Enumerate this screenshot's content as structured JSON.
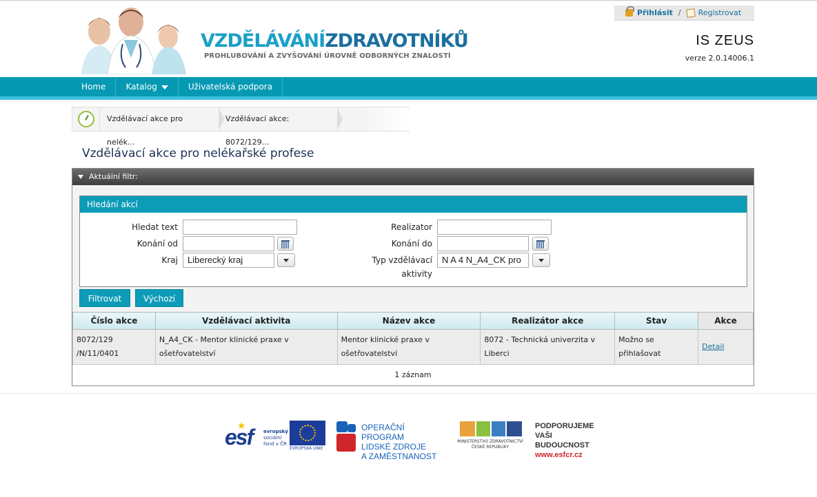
{
  "header": {
    "logo_title_a": "VZDĚLÁVÁNÍ",
    "logo_title_b": "ZDRAVOTNÍKŮ",
    "logo_subtitle": "PROHLUBOVÁNÍ A ZVYŠOVÁNÍ ÚROVNĚ ODBORNÝCH ZNALOSTÍ",
    "login_label": "Přihlásit",
    "separator": "/",
    "register_label": "Registrovat",
    "app_name": "IS ZEUS",
    "version": "verze 2.0.14006.1"
  },
  "nav": {
    "items": [
      "Home",
      "Katalog",
      "Uživatelská podpora"
    ]
  },
  "breadcrumb": {
    "items": [
      "Vzdělávací akce pro nelék...",
      "Vzdělávací akce: 8072/129..."
    ]
  },
  "page": {
    "title": "Vzdělávací akce pro nelékařské profese"
  },
  "filter": {
    "header": "Aktuální filtr:",
    "search_header": "Hledání akcí",
    "labels": {
      "hledat_text": "Hledat text",
      "konani_od": "Konání od",
      "kraj": "Kraj",
      "realizator": "Realizator",
      "konani_do": "Konání do",
      "typ_line1": "Typ vzdělávací",
      "typ_line2": "aktivity"
    },
    "values": {
      "hledat_text": "",
      "konani_od": "",
      "kraj": "Liberecký kraj",
      "realizator": "",
      "konani_do": "",
      "typ": "N A 4 N_A4_CK pro"
    },
    "buttons": {
      "filter": "Filtrovat",
      "default": "Výchozí"
    }
  },
  "table": {
    "columns": [
      "Číslo akce",
      "Vzdělávací aktivita",
      "Název akce",
      "Realizátor akce",
      "Stav",
      "Akce"
    ],
    "rows": [
      {
        "cislo_l1": "8072/129",
        "cislo_l2": "/N/11/0401",
        "aktivita_l1": "N_A4_CK - Mentor klinické praxe v",
        "aktivita_l2": "ošetřovatelství",
        "nazev_l1": "Mentor klinické praxe v",
        "nazev_l2": "ošetřovatelství",
        "realizator_l1": "8072 - Technická univerzita v",
        "realizator_l2": "Liberci",
        "stav_l1": "Možno se",
        "stav_l2": "přihlašovat",
        "akce": "Detail"
      }
    ],
    "footer": "1 záznam"
  },
  "footer_logos": {
    "esf_big": "esf",
    "esf_small_l1": "evropský",
    "esf_small_l2": "sociální",
    "esf_small_l3": "fond v ČR",
    "eu_label": "EVROPSKÁ UNIE",
    "op_l1": "OPERAČNÍ PROGRAM",
    "op_l2": "LIDSKÉ ZDROJE",
    "op_l3": "A ZAMĚSTNANOST",
    "mzd_l1": "MINISTERSTVO ZDRAVOTNICTVÍ",
    "mzd_l2": "ČESKÉ REPUBLIKY",
    "support_l1": "PODPORUJEME",
    "support_l2": "VAŠI BUDOUCNOST",
    "support_url": "www.esfcr.cz"
  }
}
